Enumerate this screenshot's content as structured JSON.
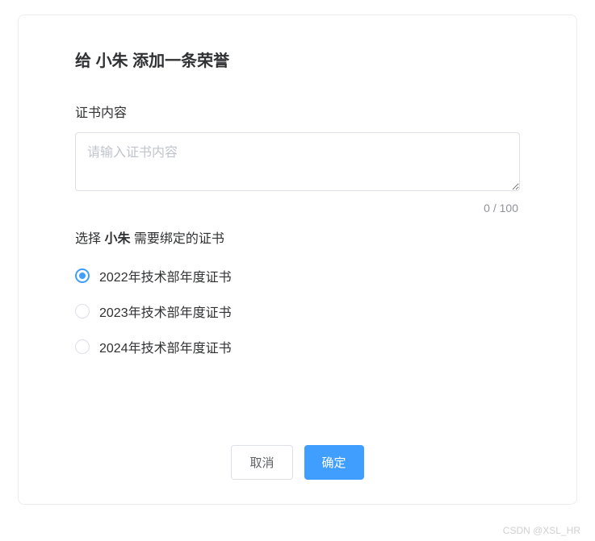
{
  "title": {
    "prefix": "给 ",
    "name": "小朱",
    "suffix": " 添加一条荣誉"
  },
  "content_field": {
    "label": "证书内容",
    "placeholder": "请输入证书内容",
    "value": "",
    "char_count": "0 / 100"
  },
  "bind_section": {
    "prefix": "选择 ",
    "name": "小朱",
    "suffix": " 需要绑定的证书"
  },
  "radio_options": [
    {
      "label": "2022年技术部年度证书",
      "selected": true
    },
    {
      "label": "2023年技术部年度证书",
      "selected": false
    },
    {
      "label": "2024年技术部年度证书",
      "selected": false
    }
  ],
  "buttons": {
    "cancel": "取消",
    "confirm": "确定"
  },
  "watermark": "CSDN @XSL_HR",
  "colors": {
    "primary": "#409eff",
    "border": "#dcdfe6",
    "text": "#303133",
    "placeholder": "#c0c4cc"
  }
}
